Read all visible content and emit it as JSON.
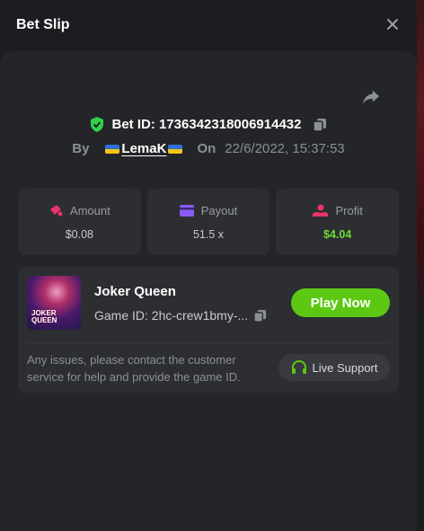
{
  "header": {
    "title": "Bet Slip"
  },
  "bet": {
    "id_label": "Bet ID: 1736342318006914432",
    "by_label": "By",
    "username": "LemaK",
    "on_label": "On",
    "date": "22/6/2022, 15:37:53"
  },
  "stats": [
    {
      "label": "Amount",
      "value": "$0.08",
      "color": "#c8cad0",
      "icon_color": "#e8356a"
    },
    {
      "label": "Payout",
      "value": "51.5 x",
      "color": "#c8cad0",
      "icon_color": "#8a5cf6"
    },
    {
      "label": "Profit",
      "value": "$4.04",
      "color": "#6fdc2f",
      "icon_color": "#e8356a"
    }
  ],
  "game": {
    "name": "Joker Queen",
    "id_label": "Game ID: 2hc-crew1bmy-...",
    "thumb_text_line1": "JOKER",
    "thumb_text_line2": "QUEEN",
    "play_label": "Play Now",
    "notice": "Any issues, please contact the customer service for help and provide the game ID.",
    "support_label": "Live Support"
  },
  "colors": {
    "accent_green": "#5dc814",
    "profit_green": "#6fdc2f",
    "shield_green": "#2fd14a",
    "background": "#1c1d20"
  },
  "icons": [
    "close-icon",
    "share-icon",
    "shield-check-icon",
    "copy-icon",
    "flag-ukraine-icon",
    "amount-icon",
    "payout-card-icon",
    "profit-hand-icon",
    "headset-icon"
  ]
}
